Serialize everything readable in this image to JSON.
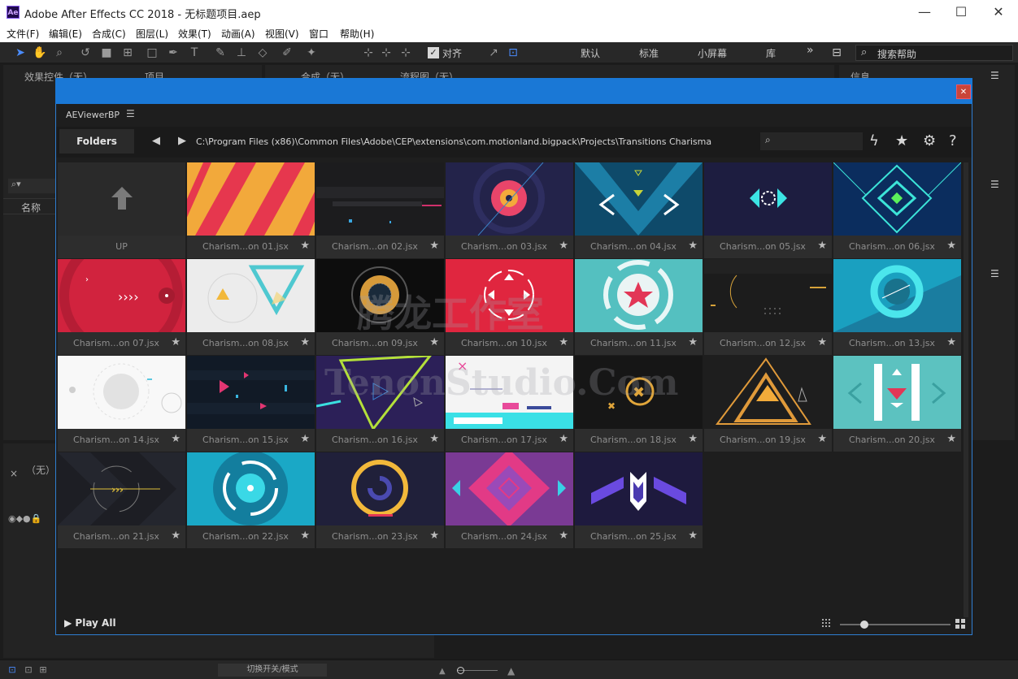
{
  "window": {
    "title": "Adobe After Effects CC 2018 - 无标题项目.aep",
    "icon_label": "Ae",
    "minimize": "—",
    "maximize": "☐",
    "close": "✕"
  },
  "menu": [
    "文件(F)",
    "编辑(E)",
    "合成(C)",
    "图层(L)",
    "效果(T)",
    "动画(A)",
    "视图(V)",
    "窗口",
    "帮助(H)"
  ],
  "toolbar": {
    "align_label": "对齐",
    "workspaces": [
      "默认",
      "标准",
      "小屏幕",
      "库"
    ],
    "more": "»",
    "search_placeholder": "搜索帮助"
  },
  "panels": {
    "effects_tab": "效果控件（无）",
    "project_tab": "项目",
    "comp_tab": "合成（无）",
    "flow_tab": "流程图（无）",
    "info_tab": "信息",
    "name_header": "名称",
    "timeline_none": "（无）",
    "status_toggle": "切换开关/模式"
  },
  "viewer": {
    "title": "AEViewerBP",
    "menu_icon": "☰",
    "folders_label": "Folders",
    "path": "C:\\Program Files (x86)\\Common Files\\Adobe\\CEP\\extensions\\com.motionland.bigpack\\Projects\\Transitions Charisma",
    "up_label": "UP",
    "play_all": "Play All",
    "items": [
      "Charism...on 01.jsx",
      "Charism...on 02.jsx",
      "Charism...on 03.jsx",
      "Charism...on 04.jsx",
      "Charism...on 05.jsx",
      "Charism...on 06.jsx",
      "Charism...on 07.jsx",
      "Charism...on 08.jsx",
      "Charism...on 09.jsx",
      "Charism...on 10.jsx",
      "Charism...on 11.jsx",
      "Charism...on 12.jsx",
      "Charism...on 13.jsx",
      "Charism...on 14.jsx",
      "Charism...on 15.jsx",
      "Charism...on 16.jsx",
      "Charism...on 17.jsx",
      "Charism...on 18.jsx",
      "Charism...on 19.jsx",
      "Charism...on 20.jsx",
      "Charism...on 21.jsx",
      "Charism...on 22.jsx",
      "Charism...on 23.jsx",
      "Charism...on 24.jsx",
      "Charism...on 25.jsx"
    ],
    "star": "★",
    "thumb_size_level": 0.2
  },
  "watermark": {
    "cn": "腾龙工作室",
    "en": "TenonStudio.Com"
  },
  "colors": {
    "accent": "#1a78d6",
    "close": "#c9453a"
  }
}
